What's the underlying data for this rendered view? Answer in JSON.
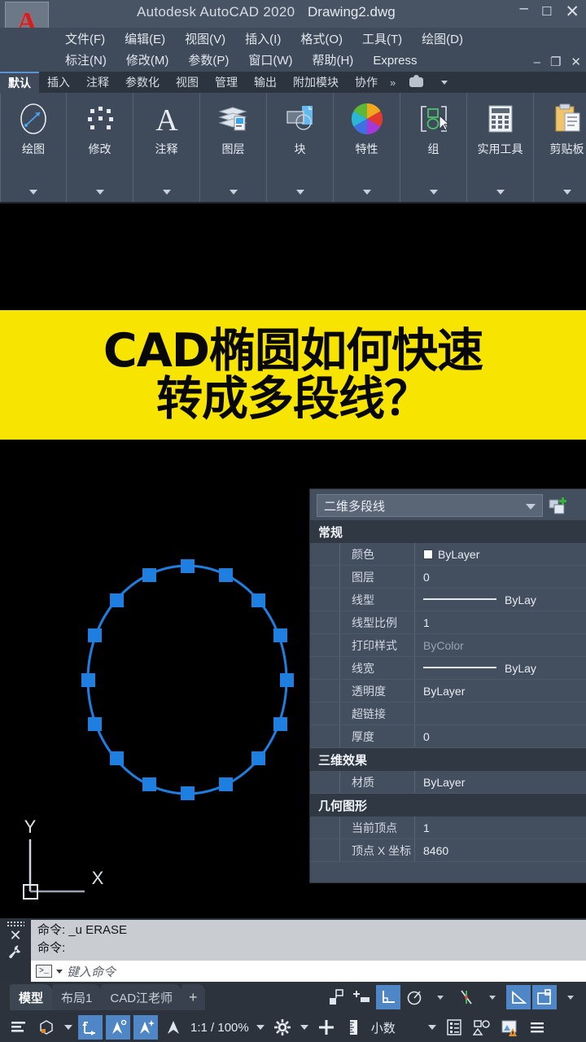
{
  "titlebar": {
    "app_title": "Autodesk AutoCAD 2020",
    "file_name": "Drawing2.dwg",
    "minimize": "–",
    "maximize": "☐",
    "close": "✕",
    "logo_letter": "A"
  },
  "menubar": {
    "row1": [
      "文件(F)",
      "编辑(E)",
      "视图(V)",
      "插入(I)",
      "格式(O)",
      "工具(T)",
      "绘图(D)"
    ],
    "row2": [
      "标注(N)",
      "修改(M)",
      "参数(P)",
      "窗口(W)",
      "帮助(H)",
      "Express"
    ],
    "doc_minimize": "–",
    "doc_restore": "❐",
    "doc_close": "✕"
  },
  "ribbon_tabs": {
    "items": [
      "默认",
      "插入",
      "注释",
      "参数化",
      "视图",
      "管理",
      "输出",
      "附加模块",
      "协作"
    ],
    "active": "默认",
    "overflow": "»"
  },
  "ribbon_panels": [
    {
      "label": "绘图",
      "icon": "draw-ellipse-icon"
    },
    {
      "label": "修改",
      "icon": "modify-dots-icon"
    },
    {
      "label": "注释",
      "icon": "annotate-text-icon"
    },
    {
      "label": "图层",
      "icon": "layers-icon"
    },
    {
      "label": "块",
      "icon": "block-icon"
    },
    {
      "label": "特性",
      "icon": "properties-colorwheel-icon"
    },
    {
      "label": "组",
      "icon": "group-icon"
    },
    {
      "label": "实用工具",
      "icon": "utilities-calculator-icon"
    },
    {
      "label": "剪贴板",
      "icon": "clipboard-icon"
    }
  ],
  "banner": {
    "line1": "CAD椭圆如何快速",
    "line2": "转成多段线？",
    "background": "#f7e400",
    "text_color": "#080808"
  },
  "canvas": {
    "background": "#000000",
    "ucs_x_label": "X",
    "ucs_y_label": "Y",
    "entity": {
      "name": "polyline-ellipse",
      "grip_color": "#1f7fe0",
      "vertex_count": 16
    }
  },
  "properties": {
    "combo_value": "二维多段线",
    "new_icon": "quick-select-icon",
    "groups": [
      {
        "title": "常规",
        "rows": [
          {
            "name": "颜色",
            "value": "ByLayer",
            "kind": "color"
          },
          {
            "name": "图层",
            "value": "0",
            "kind": "text"
          },
          {
            "name": "线型",
            "value": "ByLay",
            "kind": "linetype"
          },
          {
            "name": "线型比例",
            "value": "1",
            "kind": "text"
          },
          {
            "name": "打印样式",
            "value": "ByColor",
            "kind": "dim"
          },
          {
            "name": "线宽",
            "value": "ByLay",
            "kind": "linetype"
          },
          {
            "name": "透明度",
            "value": "ByLayer",
            "kind": "text"
          },
          {
            "name": "超链接",
            "value": "",
            "kind": "text"
          },
          {
            "name": "厚度",
            "value": "0",
            "kind": "text"
          }
        ]
      },
      {
        "title": "三维效果",
        "rows": [
          {
            "name": "材质",
            "value": "ByLayer",
            "kind": "text"
          }
        ]
      },
      {
        "title": "几何图形",
        "rows": [
          {
            "name": "当前顶点",
            "value": "1",
            "kind": "text"
          },
          {
            "name": "顶点 X 坐标",
            "value": "8460",
            "kind": "text"
          }
        ]
      }
    ]
  },
  "command": {
    "history_line1": "命令: _u ERASE",
    "history_line2": "命令:",
    "placeholder": "键入命令",
    "prompt_glyph": ">_",
    "close_glyph": "✕"
  },
  "layout_tabs": {
    "items": [
      "模型",
      "布局1",
      "CAD江老师"
    ],
    "active": "模型",
    "add_label": "+"
  },
  "status": {
    "scale": "1:1 / 100%",
    "units": "小数",
    "toggles": [
      {
        "name": "object-snap-tracking",
        "on": false
      },
      {
        "name": "snap-endpoint",
        "on": false
      },
      {
        "name": "ortho-mode",
        "on": true
      },
      {
        "name": "polar-tracking",
        "on": false
      },
      {
        "name": "object-snap",
        "on": false
      },
      {
        "name": "angle-snap",
        "on": true
      },
      {
        "name": "object-snap-box",
        "on": true
      }
    ],
    "bottom_toggles": [
      {
        "name": "model-space",
        "on": false
      },
      {
        "name": "workspace-cube",
        "on": false
      },
      {
        "name": "annotation-scale-lock",
        "on": true
      },
      {
        "name": "annotation-visibility",
        "on": true
      },
      {
        "name": "annotation-auto-add",
        "on": true
      },
      {
        "name": "annotation-monitor",
        "on": false
      }
    ]
  }
}
